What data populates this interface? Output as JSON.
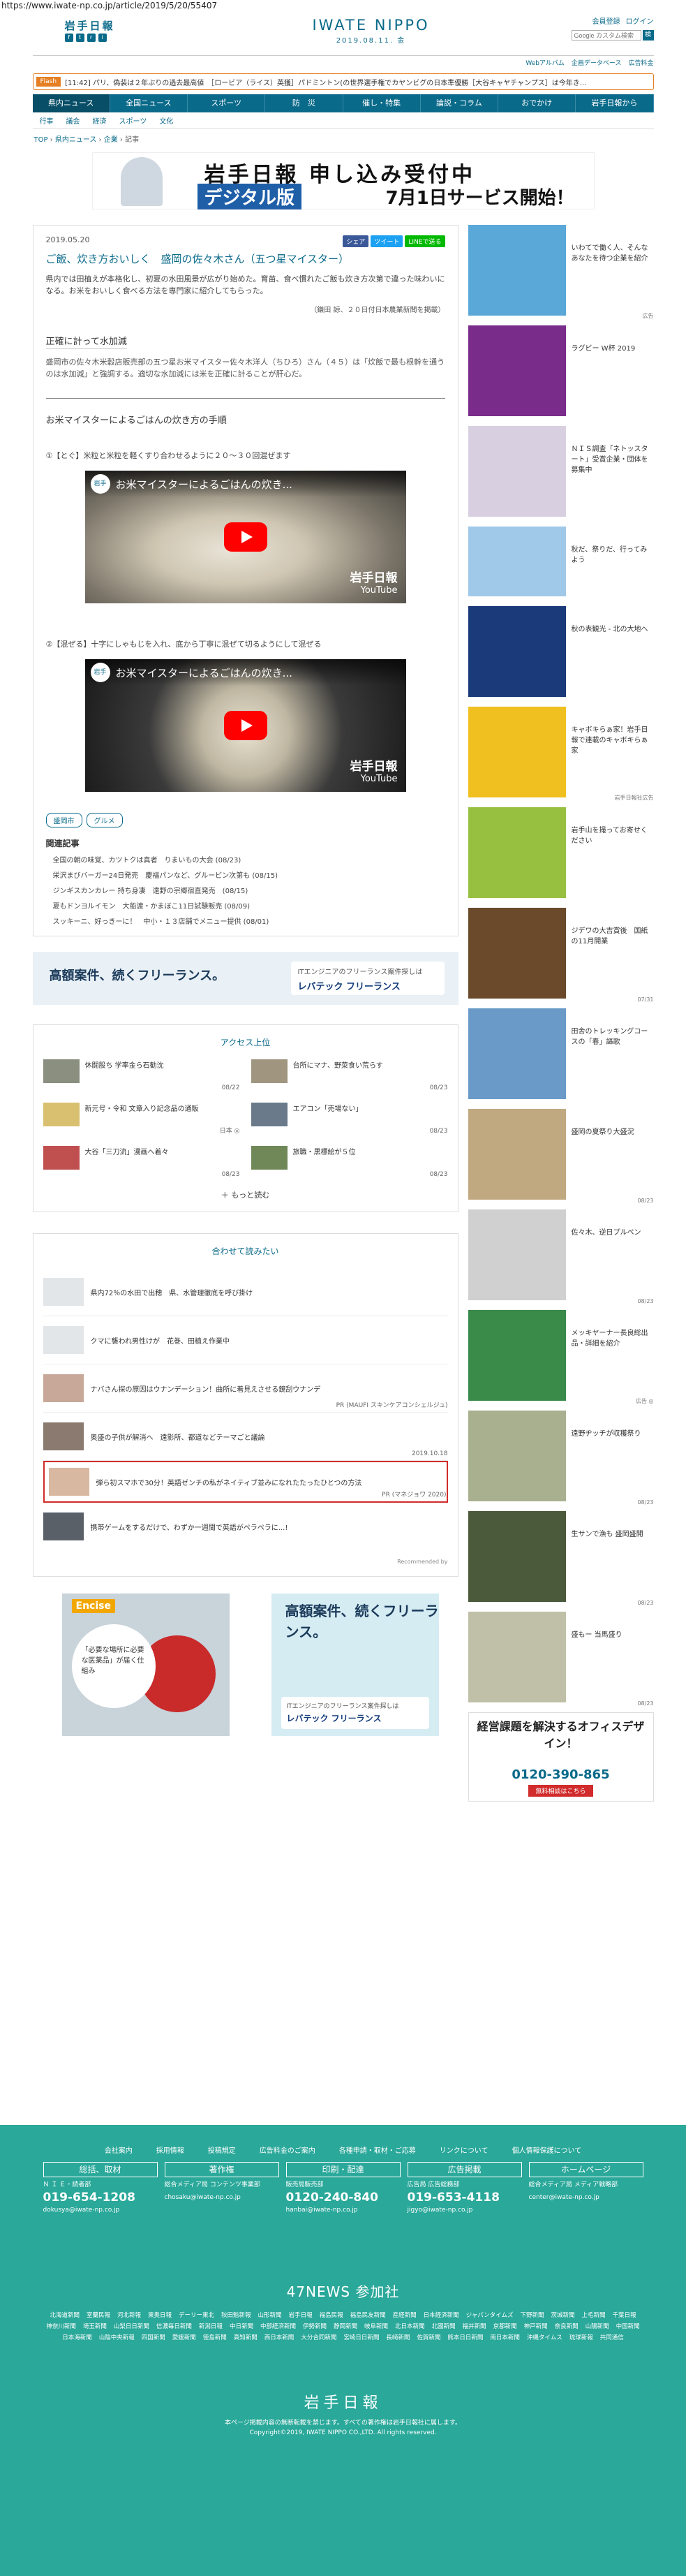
{
  "url": "https://www.iwate-np.co.jp/article/2019/5/20/55407",
  "header": {
    "logo_small": "岩手日報",
    "brand": "IWATE NIPPO",
    "brand_date": "2019.08.11. 金",
    "login": [
      "会員登録",
      "ログイン"
    ],
    "search_placeholder": "Google カスタム検索",
    "search_btn": "検",
    "subnav": [
      "Webアルバム",
      "企画データベース",
      "広告料金"
    ]
  },
  "flash": {
    "tag": "Flash",
    "text": "[11:42] パリ、偽装は２年ぶりの過去最高値　［ロービア（ライス）英獲］パドミントン(の世界選手権でカヤンビグの日本準優勝［大谷キャヤチャンプス］は今年き..."
  },
  "nav": {
    "main": [
      "県内ニュース",
      "全国ニュース",
      "スポーツ",
      "防　災",
      "催し・特集",
      "論説・コラム",
      "おでかけ",
      "岩手日報から"
    ],
    "sub": [
      "行事",
      "議会",
      "経済",
      "スポーツ",
      "文化"
    ]
  },
  "breadcrumb": [
    "TOP",
    "県内ニュース",
    "企業",
    "記事"
  ],
  "banner": {
    "line1": "岩手日報 申し込み受付中",
    "line2": "デジタル版",
    "line3": "7月1日サービス開始！"
  },
  "article": {
    "date": "2019.05.20",
    "share": [
      "シェア",
      "ツイート",
      "LINEで送る"
    ],
    "title": "ご飯、炊き方おいしく　盛岡の佐々木さん（五つ星マイスター）",
    "lead": "県内では田植えが本格化し、初夏の水田風景が広がり始めた。育苗、食べ慣れたご飯も炊き方次第で違った味わいになる。お米をおいしく食べる方法を専門家に紹介してもらった。",
    "note": "（鎌田 諒、２０日付日本農業新聞を掲載）",
    "h2": "正確に計って水加減",
    "para": "盛岡市の佐々木米穀店販売部の五つ星お米マイスター佐々木洋人（ちひろ）さん（４５）は「炊飯で最も根幹を通うのは水加減」と強調する。適切な水加減には米を正確に計ることが肝心だ。",
    "h3": "お米マイスターによるごはんの炊き方の手順",
    "step1": "①【とぐ】米粒と米粒を軽くすり合わせるように２０～３０回混ぜます",
    "step2": "②【混ぜる】十字にしゃもじを入れ、底から丁寧に混ぜて切るようにして混ぜる",
    "video_title": "お米マイスターによるごはんの炊き...",
    "video_avatar": "岩手",
    "video_wm1": "岩手日報",
    "video_wm2": "YouTube",
    "tags": [
      "盛岡市",
      "グルメ"
    ],
    "related_h": "関連記事",
    "related": [
      "全国の朝の味覚、カツトクは真者　りまいもの大会 (08/23)",
      "栄沢まびバーガー24日発売　慶福パンなど、グルービン次第も (08/15)",
      "ジンギスカンカレー 持ち身凄　遠野の宗郷宿直発売　(08/15)",
      "夏もドンヨルイモン　大船渡・かまぼこ11日試験販売 (08/09)",
      "スッキーニ、好っきーに！　中小・１３店舗でメニュー提供 (08/01)"
    ]
  },
  "ad_wide": {
    "text": "高額案件、続くフリーランス。",
    "sub": "ITエンジニアのフリーランス案件探しは",
    "brand": "レバテック フリーランス"
  },
  "ranking": {
    "title": "アクセス上位",
    "items": [
      {
        "text": "休闘股ち 学率金ら石勧沈",
        "rank": "08/22"
      },
      {
        "text": "台所にマナ、野菜食い荒らす",
        "rank": "08/23"
      },
      {
        "text": "新元号・令和 文章入り記念品の通販",
        "rank": "日本 ◎"
      },
      {
        "text": "エアコン「売場ない」",
        "rank": "08/23"
      },
      {
        "text": "大谷「三刀流」漫画へ着々",
        "rank": "08/23"
      },
      {
        "text": "旅職・黒標絵が５位",
        "rank": "08/23"
      }
    ],
    "more": "もっと読む"
  },
  "read_more": {
    "title": "合わせて読みたい",
    "items": [
      {
        "text": "県内72％の水田で出穂　県、水管理徹底を呼び掛け",
        "date": ""
      },
      {
        "text": "クマに襲われ男性けが　花巻、田植え作業中",
        "date": ""
      },
      {
        "text": "ナバさん探の原因はウナンデーション！曲所に着見えさせる鏡刮ウナンデ",
        "date": "PR (MAUFI スキンケアコンシェルジュ)"
      },
      {
        "text": "奥盛の子供が解消へ　遠影所、都道などテーマごと議論",
        "date": "2019.10.18"
      },
      {
        "text": "弾ら初スマホで30分！英語ゼンチの私がネイティブ並みになれたたったひとつの方法",
        "date": "PR (マネジョワ 2020)"
      },
      {
        "text": "携帯ゲームをするだけで、わずか一週間で英語がペラペラに...!",
        "date": ""
      }
    ],
    "rec": "Recommended by"
  },
  "bottom_ads": {
    "ad1_tag": "Encise",
    "ad1_text": "「必要な場所に必要な医薬品」が届く仕組み",
    "ad2_text": "高額案件、続くフリーランス。",
    "ad2_sub": "ITエンジニアのフリーランス案件探しは",
    "ad2_brand": "レバテック フリーランス"
  },
  "side": {
    "items": [
      {
        "text": "いわてで働く人、そんなあなたを待つ企業を紹介",
        "date": "広告",
        "color": "#5aa8d8"
      },
      {
        "text": "ラグビー W杯 2019",
        "date": "",
        "color": "#7a2c8a"
      },
      {
        "text": "ＮＩＳ調査「ネトッスタート」受賞企業・団体を募集中",
        "date": "",
        "color": "#d8d0e0"
      },
      {
        "text": "秋だ、祭りだ、行ってみよう",
        "date": "",
        "color": "#a0c8e8"
      },
      {
        "text": "秋の表観光 ‐ 北の大地へ",
        "date": "",
        "color": "#1b3a7a"
      },
      {
        "text": "キャボキらぁ家！岩手日報で連載のキャボキらぁ家",
        "date": "岩手日報社広告",
        "color": "#f0c020"
      },
      {
        "text": "岩手山を撮ってお寄せください",
        "date": "",
        "color": "#98c040"
      },
      {
        "text": "ジデワの大吉賞後　国紙の11月開業",
        "date": "07/31",
        "color": "#6a4a2a"
      },
      {
        "text": "田舎のトレッキングコースの「春」謳歌",
        "date": "",
        "color": "#6a9ac8"
      },
      {
        "text": "盛岡の夏祭り大盛況",
        "date": "08/23",
        "color": "#c0a880"
      },
      {
        "text": "佐々木、逆日プルペン",
        "date": "08/23",
        "color": "#d0d0d0"
      },
      {
        "text": "メッキヤーナー長良総出品・詳細を紹介",
        "date": "広告 ◎",
        "color": "#3a8a4a"
      },
      {
        "text": "遠野ヂッチが収穫祭り",
        "date": "08/23",
        "color": "#a8b090"
      },
      {
        "text": "生サンで漁も 盛岡盛開",
        "date": "08/23",
        "color": "#4a5a3a"
      },
      {
        "text": "盛もー 当馬盛り",
        "date": "08/23",
        "color": "#c0c0a8"
      }
    ],
    "ad_title": "経営課題を解決するオフィスデザイン！",
    "ad_tel": "0120-390-865",
    "ad_btn": "無料相談はこちら"
  },
  "footer": {
    "links": [
      "会社案内",
      "採用情報",
      "投稿規定",
      "広告料金のご案内",
      "各種申請・取材・ご応募",
      "リンクについて",
      "個人情報保護について"
    ],
    "cols": [
      {
        "title": "総括、取材",
        "sub": "Ｎ Ｉ Ｅ・読者部",
        "tel": "019-654-1208",
        "mail": "dokusya@iwate-np.co.jp"
      },
      {
        "title": "著作権",
        "sub": "総合メディア局 コンテンツ事業部",
        "tel": "",
        "mail": "chosaku@iwate-np.co.jp"
      },
      {
        "title": "印刷・配達",
        "sub": "販売局販売部",
        "tel": "0120-240-840",
        "mail": "hanbai@iwate-np.co.jp"
      },
      {
        "title": "広告掲載",
        "sub": "広告局 広告総務部",
        "tel": "019-653-4118",
        "mail": "jigyo@iwate-np.co.jp"
      },
      {
        "title": "ホームページ",
        "sub": "総合メディア局 メディア戦略部",
        "tel": "",
        "mail": "center@iwate-np.co.jp"
      }
    ],
    "n47": "47NEWS 参加社",
    "papers": [
      "北海道新聞",
      "室蘭民報",
      "河北新報",
      "東奥日報",
      "デーリー東北",
      "秋田魁新報",
      "山形新聞",
      "岩手日報",
      "福島民報",
      "福島民友新聞",
      "産経新聞",
      "日本経済新聞",
      "ジャパンタイムズ",
      "下野新聞",
      "茨城新聞",
      "上毛新聞",
      "千葉日報",
      "神奈川新聞",
      "埼玉新聞",
      "山梨日日新聞",
      "信濃毎日新聞",
      "新潟日報",
      "中日新聞",
      "中部経済新聞",
      "伊勢新聞",
      "静岡新聞",
      "岐阜新聞",
      "北日本新聞",
      "北國新聞",
      "福井新聞",
      "京都新聞",
      "神戸新聞",
      "奈良新聞",
      "山陽新聞",
      "中国新聞",
      "日本海新聞",
      "山陰中央新報",
      "四国新聞",
      "愛媛新聞",
      "徳島新聞",
      "高知新聞",
      "西日本新聞",
      "大分合同新聞",
      "宮崎日日新聞",
      "長崎新聞",
      "佐賀新聞",
      "熊本日日新聞",
      "南日本新聞",
      "沖縄タイムス",
      "琉球新報",
      "共同通信"
    ],
    "logo": "岩手日報",
    "copy1": "本ページ掲載内容の無断転載を禁じます。すべての著作権は岩手日報社に属します。",
    "copy2": "Copyright©2019, IWATE NIPPO CO.,LTD. All rights reserved."
  }
}
